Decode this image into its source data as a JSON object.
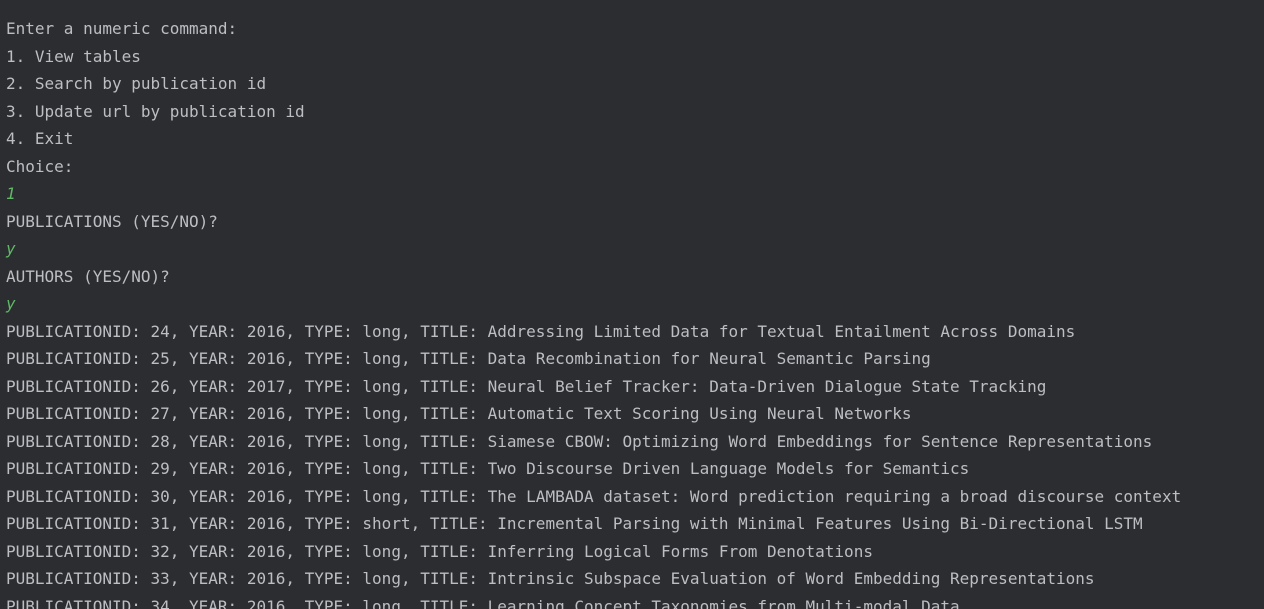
{
  "console": {
    "lines": [
      {
        "text": "Enter a numeric command:",
        "kind": "output"
      },
      {
        "text": "1. View tables",
        "kind": "output"
      },
      {
        "text": "2. Search by publication id",
        "kind": "output"
      },
      {
        "text": "3. Update url by publication id",
        "kind": "output"
      },
      {
        "text": "4. Exit",
        "kind": "output"
      },
      {
        "text": "Choice:",
        "kind": "output"
      },
      {
        "text": "1",
        "kind": "input"
      },
      {
        "text": "PUBLICATIONS (YES/NO)?",
        "kind": "output"
      },
      {
        "text": "y",
        "kind": "input"
      },
      {
        "text": "AUTHORS (YES/NO)?",
        "kind": "output"
      },
      {
        "text": "y",
        "kind": "input"
      },
      {
        "text": "PUBLICATIONID: 24, YEAR: 2016, TYPE: long, TITLE: Addressing Limited Data for Textual Entailment Across Domains",
        "kind": "output"
      },
      {
        "text": "PUBLICATIONID: 25, YEAR: 2016, TYPE: long, TITLE: Data Recombination for Neural Semantic Parsing",
        "kind": "output"
      },
      {
        "text": "PUBLICATIONID: 26, YEAR: 2017, TYPE: long, TITLE: Neural Belief Tracker: Data-Driven Dialogue State Tracking",
        "kind": "output"
      },
      {
        "text": "PUBLICATIONID: 27, YEAR: 2016, TYPE: long, TITLE: Automatic Text Scoring Using Neural Networks",
        "kind": "output"
      },
      {
        "text": "PUBLICATIONID: 28, YEAR: 2016, TYPE: long, TITLE: Siamese CBOW: Optimizing Word Embeddings for Sentence Representations",
        "kind": "output"
      },
      {
        "text": "PUBLICATIONID: 29, YEAR: 2016, TYPE: long, TITLE: Two Discourse Driven Language Models for Semantics",
        "kind": "output"
      },
      {
        "text": "PUBLICATIONID: 30, YEAR: 2016, TYPE: long, TITLE: The LAMBADA dataset: Word prediction requiring a broad discourse context",
        "kind": "output"
      },
      {
        "text": "PUBLICATIONID: 31, YEAR: 2016, TYPE: short, TITLE: Incremental Parsing with Minimal Features Using Bi-Directional LSTM",
        "kind": "output"
      },
      {
        "text": "PUBLICATIONID: 32, YEAR: 2016, TYPE: long, TITLE: Inferring Logical Forms From Denotations",
        "kind": "output"
      },
      {
        "text": "PUBLICATIONID: 33, YEAR: 2016, TYPE: long, TITLE: Intrinsic Subspace Evaluation of Word Embedding Representations",
        "kind": "output"
      },
      {
        "text": "PUBLICATIONID: 34, YEAR: 2016, TYPE: long, TITLE: Learning Concept Taxonomies from Multi-modal Data",
        "kind": "output"
      }
    ]
  },
  "colors": {
    "background": "#2b2d30",
    "output_text": "#bcbec4",
    "user_input": "#5fb865"
  }
}
